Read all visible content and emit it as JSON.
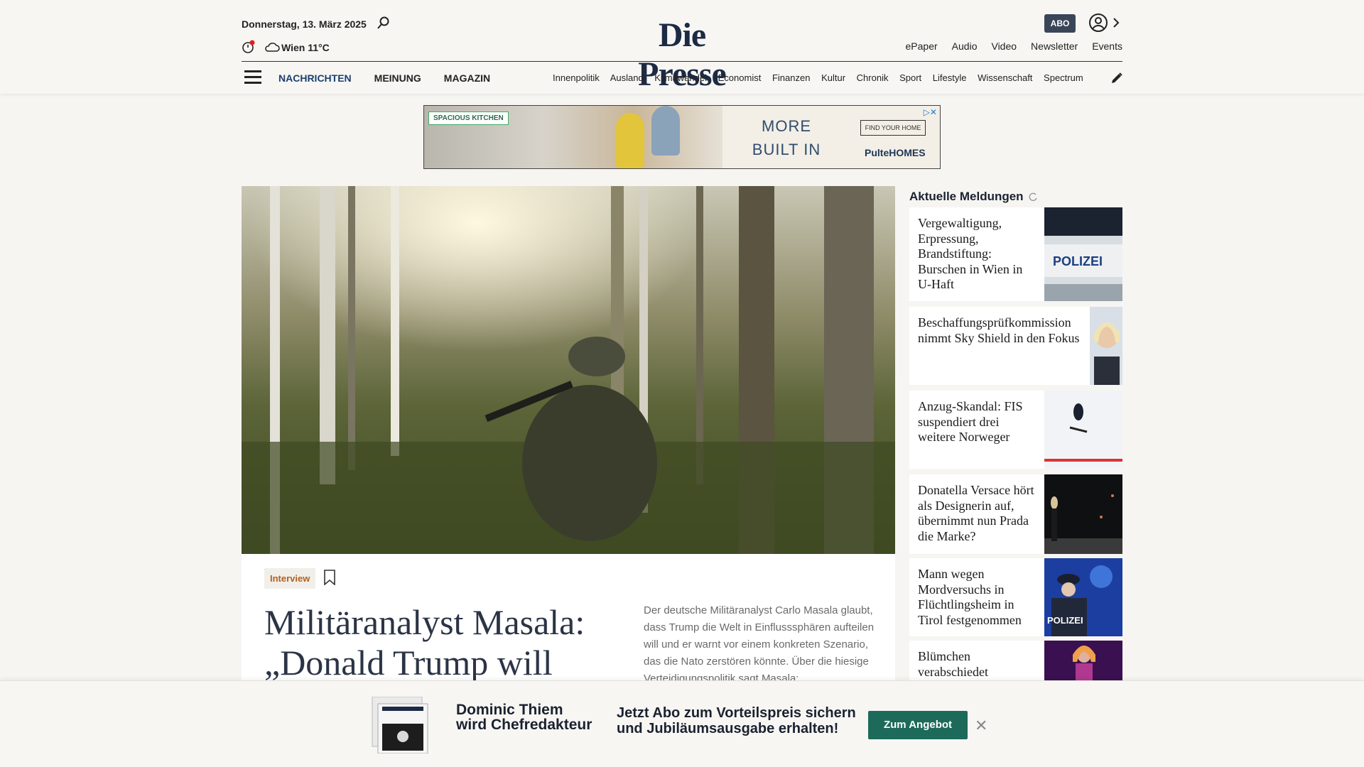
{
  "header": {
    "date": "Donnerstag, 13. März 2025",
    "weather": "Wien 11°C",
    "logo": "Die Presse",
    "abo_label": "ABO",
    "top_links": [
      "ePaper",
      "Audio",
      "Video",
      "Newsletter",
      "Events"
    ],
    "main_nav": [
      "NACHRICHTEN",
      "MEINUNG",
      "MAGAZIN"
    ],
    "sub_nav": [
      "Innenpolitik",
      "Ausland",
      "Klimawandel",
      "Economist",
      "Finanzen",
      "Kultur",
      "Chronik",
      "Sport",
      "Lifestyle",
      "Wissenschaft",
      "Spectrum"
    ]
  },
  "ad": {
    "tag": "SPACIOUS KITCHEN",
    "line1": "MORE",
    "line2": "BUILT IN",
    "button": "FIND YOUR HOME",
    "brand": "PulteHOMES"
  },
  "article": {
    "tag": "Interview",
    "headline_line1": "Militäranalyst Masala:",
    "headline_line2": "„Donald Trump will",
    "teaser": "Der deutsche Militäranalyst Carlo Masala glaubt, dass Trump die Welt in Einflusssphären aufteilen will und er warnt vor einem konkreten Szenario, das die Nato zerstören könnte. Über die hiesige Verteidigungspolitik sagt Masala:"
  },
  "sidebar": {
    "title": "Aktuelle Meldungen",
    "items": [
      {
        "text": "Vergewaltigung, Erpressung, Brandstiftung: Burschen in Wien in U-Haft"
      },
      {
        "text": "Beschaffungsprüfkommission nimmt Sky Shield in den Fokus"
      },
      {
        "text": "Anzug-Skandal: FIS suspendiert drei weitere Norweger"
      },
      {
        "text": "Donatella Versace hört als Designerin auf, übernimmt nun Prada die Marke?"
      },
      {
        "text": "Mann wegen Mordversuchs in Flüchtlingsheim in Tirol festgenommen"
      },
      {
        "text": "Blümchen verabschiedet"
      }
    ]
  },
  "banner": {
    "name_line1": "Dominic Thiem",
    "name_line2": "wird Chefredakteur",
    "offer_line1": "Jetzt Abo zum Vorteilspreis sichern",
    "offer_line2": "und Jubiläumsausgabe erhalten!",
    "button": "Zum Angebot"
  },
  "colors": {
    "brand_navy": "#1c2a44",
    "tag_orange": "#b35f1f",
    "cta_green": "#1e6a5a"
  }
}
